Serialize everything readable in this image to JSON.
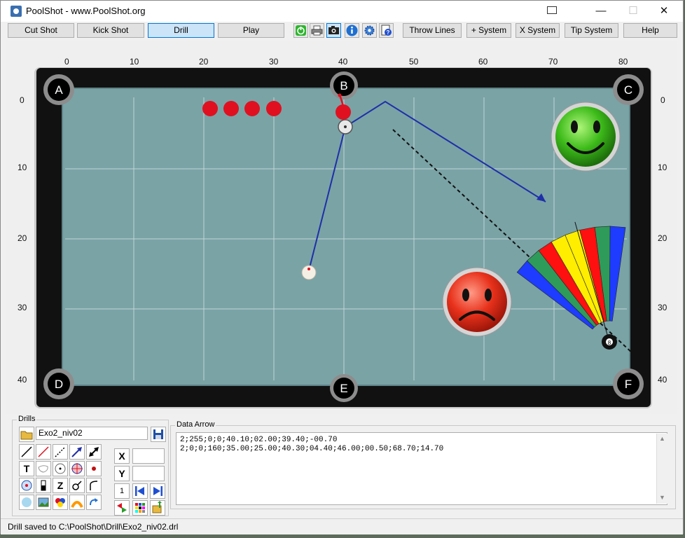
{
  "window": {
    "title": "PoolShot - www.PoolShot.org",
    "min_symbol": "—",
    "max_symbol": "☐",
    "close_symbol": "✕"
  },
  "toolbar": {
    "buttons": [
      "Cut Shot",
      "Kick Shot",
      "Drill",
      "Play",
      "Throw Lines",
      "+ System",
      "X System",
      "Tip System",
      "Help"
    ],
    "active": "Drill",
    "icons": [
      "power-icon",
      "printer-icon",
      "camera-icon",
      "info-icon",
      "settings-icon",
      "help-doc-icon"
    ]
  },
  "table": {
    "x_ticks": [
      "0",
      "10",
      "20",
      "30",
      "40",
      "50",
      "60",
      "70",
      "80"
    ],
    "y_ticks": [
      "0",
      "10",
      "20",
      "30",
      "40"
    ],
    "pockets": [
      "A",
      "B",
      "C",
      "D",
      "E",
      "F"
    ],
    "colors": {
      "felt": "#7aa3a6",
      "rail": "#111111",
      "frame": "#c9c9c9",
      "path": "#1f2fa8",
      "red_ball": "#e01020"
    },
    "fan_colors": [
      "#1e3cff",
      "#2e9b5b",
      "#ff1010",
      "#ffee00",
      "#ffee00",
      "#ff1010",
      "#2e9b5b",
      "#1e3cff"
    ],
    "eight_ball_label": "8"
  },
  "drills": {
    "label": "Drills",
    "filename": "Exo2_niv02",
    "x_label": "X",
    "y_label": "Y",
    "x_value": "",
    "y_value": "",
    "text_tool": "T",
    "z_tool": "Z",
    "page_tool": "1"
  },
  "data_arrow": {
    "label": "Data Arrow",
    "line1": "2;255;0;0;40.10;02.00;39.40;-00.70",
    "line2": "2;0;0;160;35.00;25.00;40.30;04.40;46.00;00.50;68.70;14.70"
  },
  "status": {
    "text": "Drill saved to C:\\PoolShot\\Drill\\Exo2_niv02.drl"
  }
}
